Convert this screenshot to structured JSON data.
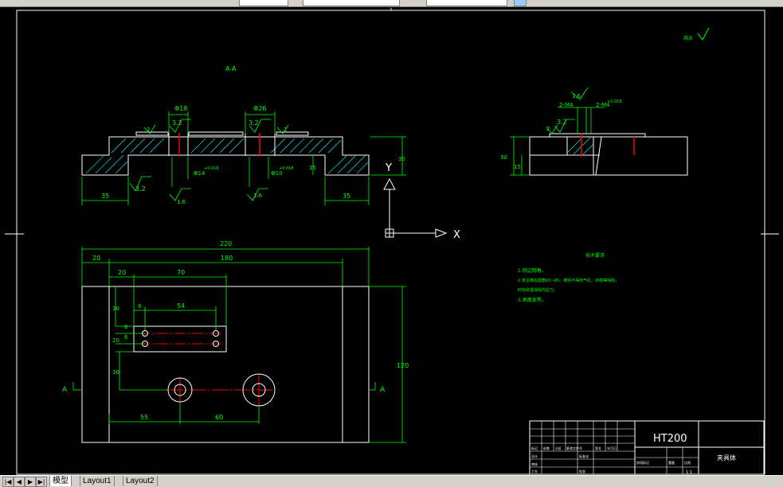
{
  "view": {
    "section_label": "A-A",
    "section_mark_left": "A",
    "section_mark_right": "A",
    "roughness_symbol": "其余",
    "ucs_x": "X",
    "ucs_y": "Y"
  },
  "dims": {
    "phi18": "Φ18",
    "phi26": "Φ26",
    "r32a": "3.2",
    "r32b": "3.2",
    "r32c": "3.2",
    "r32d": "3.2",
    "r16a": "1.6",
    "r16b": "1.6",
    "r16c": "1.6",
    "d2a": "2",
    "d2b": "2",
    "d2c": "2",
    "d35a": "35",
    "d35b": "35",
    "d15a": "15",
    "d15b": "15",
    "d30a": "30",
    "d30b": "30",
    "phi14": "Φ14",
    "phi10": "Φ10",
    "tol": "+0.018",
    "tol2": "+0.018",
    "tol3": "+0.018",
    "m4a": "2-M4",
    "m4b": "2-M4",
    "d220": "220",
    "d20a": "20",
    "d180": "180",
    "d20b": "20",
    "d70": "70",
    "d30c": "30",
    "d8a": "8",
    "d54": "54",
    "d8b": "8",
    "d6": "6",
    "d20c": "20",
    "d30d": "30",
    "d120": "120",
    "d55": "55",
    "d60": "60"
  },
  "notes": {
    "heading": "技术要求",
    "line1": "1.锐边倒角。",
    "line2": "2.未注铸造圆角R3~R5，铸件不得有气孔、砂眼等缺陷，",
    "line2b": "时效处理消除内应力。",
    "line3": "3.表面发黑。"
  },
  "titleblock": {
    "material": "HT200",
    "part_name": "夹具体",
    "cells": [
      "标记",
      "处数",
      "分区",
      "更改文件号",
      "签名",
      "年月日",
      "设计",
      "标准化",
      "阶段标记",
      "重量",
      "比例",
      "审核",
      "工艺",
      "批准",
      "1:1"
    ]
  },
  "statusbar": {
    "nav": [
      "|◀",
      "◀",
      "▶",
      "▶|"
    ],
    "tabs": [
      "模型",
      "Layout1",
      "Layout2"
    ]
  }
}
